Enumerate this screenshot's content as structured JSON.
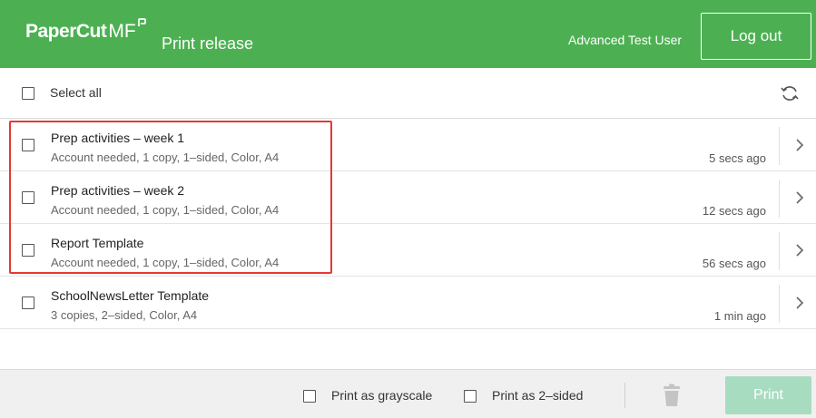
{
  "header": {
    "logo_text": "PaperCut",
    "logo_suffix": "MF",
    "title": "Print release",
    "user": "Advanced Test User",
    "logout_label": "Log out"
  },
  "select_all": {
    "label": "Select all",
    "checked": false,
    "refresh_icon": "refresh-icon"
  },
  "jobs": [
    {
      "name": "Prep activities – week 1",
      "details": "Account needed, 1 copy, 1–sided, Color, A4",
      "time": "5 secs ago",
      "checked": false
    },
    {
      "name": "Prep activities – week 2",
      "details": "Account needed, 1 copy, 1–sided, Color, A4",
      "time": "12 secs ago",
      "checked": false
    },
    {
      "name": "Report Template",
      "details": "Account needed, 1 copy, 1–sided, Color, A4",
      "time": "56 secs ago",
      "checked": false
    },
    {
      "name": "SchoolNewsLetter Template",
      "details": "3 copies, 2–sided, Color, A4",
      "time": "1 min ago",
      "checked": false
    }
  ],
  "footer": {
    "grayscale_label": "Print as grayscale",
    "two_sided_label": "Print as 2–sided",
    "delete_icon": "trash-icon",
    "print_label": "Print"
  },
  "colors": {
    "brand_green": "#4cb052",
    "print_disabled": "#a8dcc0",
    "highlight": "#e53935"
  }
}
